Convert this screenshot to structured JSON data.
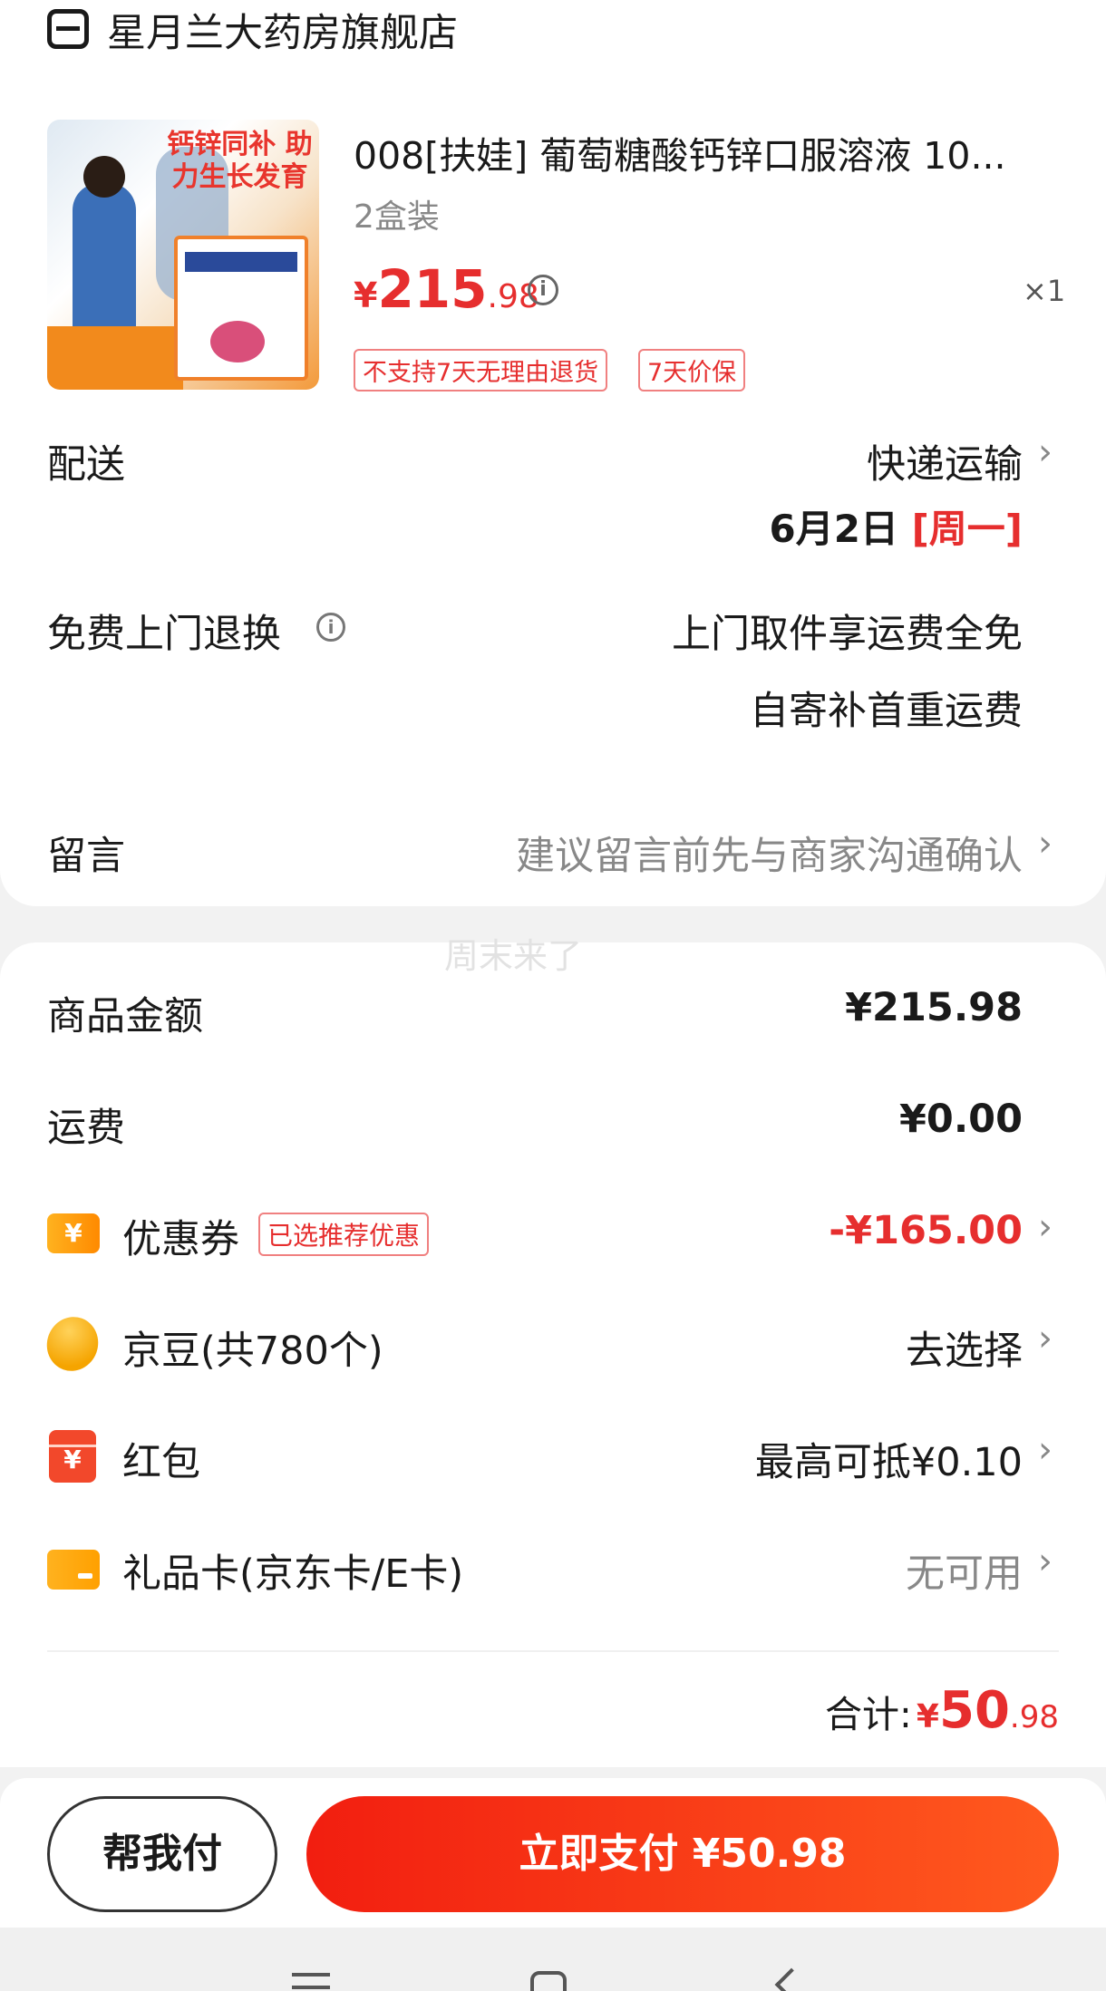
{
  "store": {
    "name": "星月兰大药房旗舰店"
  },
  "product": {
    "title": "008[扶娃] 葡萄糖酸钙锌口服溶液 10...",
    "spec": "2盒装",
    "currency": "¥",
    "price_int": "215",
    "price_dec": ".98",
    "quantity": "×1",
    "image_headline": "钙锌同补 助力生长发育",
    "tags": [
      "不支持7天无理由退货",
      "7天价保"
    ]
  },
  "delivery": {
    "label": "配送",
    "method": "快递运输",
    "date": "6月2日",
    "weekday": "[周一]"
  },
  "return_service": {
    "label": "免费上门退换",
    "line1": "上门取件享运费全免",
    "line2": "自寄补首重运费"
  },
  "message": {
    "label": "留言",
    "placeholder": "建议留言前先与商家沟通确认"
  },
  "watermark": "周末来了",
  "fees": {
    "goods_label": "商品金额",
    "goods_amount": "¥215.98",
    "shipping_label": "运费",
    "shipping_amount": "¥0.00",
    "coupon_label": "优惠券",
    "coupon_badge": "已选推荐优惠",
    "coupon_amount": "-¥165.00",
    "jd_beans_label": "京豆(共780个)",
    "jd_beans_action": "去选择",
    "redpacket_label": "红包",
    "redpacket_value": "最高可抵¥0.10",
    "giftcard_label": "礼品卡(京东卡/E卡)",
    "giftcard_value": "无可用"
  },
  "total": {
    "label": "合计:",
    "currency": "¥",
    "int": "50",
    "dec": ".98"
  },
  "actions": {
    "help_pay": "帮我付",
    "pay_now": "立即支付 ¥50.98"
  },
  "icons": {
    "coupon_glyph": "¥",
    "redpacket_glyph": "¥",
    "info_glyph": "i",
    "chevron": "›"
  },
  "colors": {
    "accent_red": "#e62e2e",
    "pay_gradient_start": "#f21e10",
    "pay_gradient_end": "#ff5a1e"
  }
}
